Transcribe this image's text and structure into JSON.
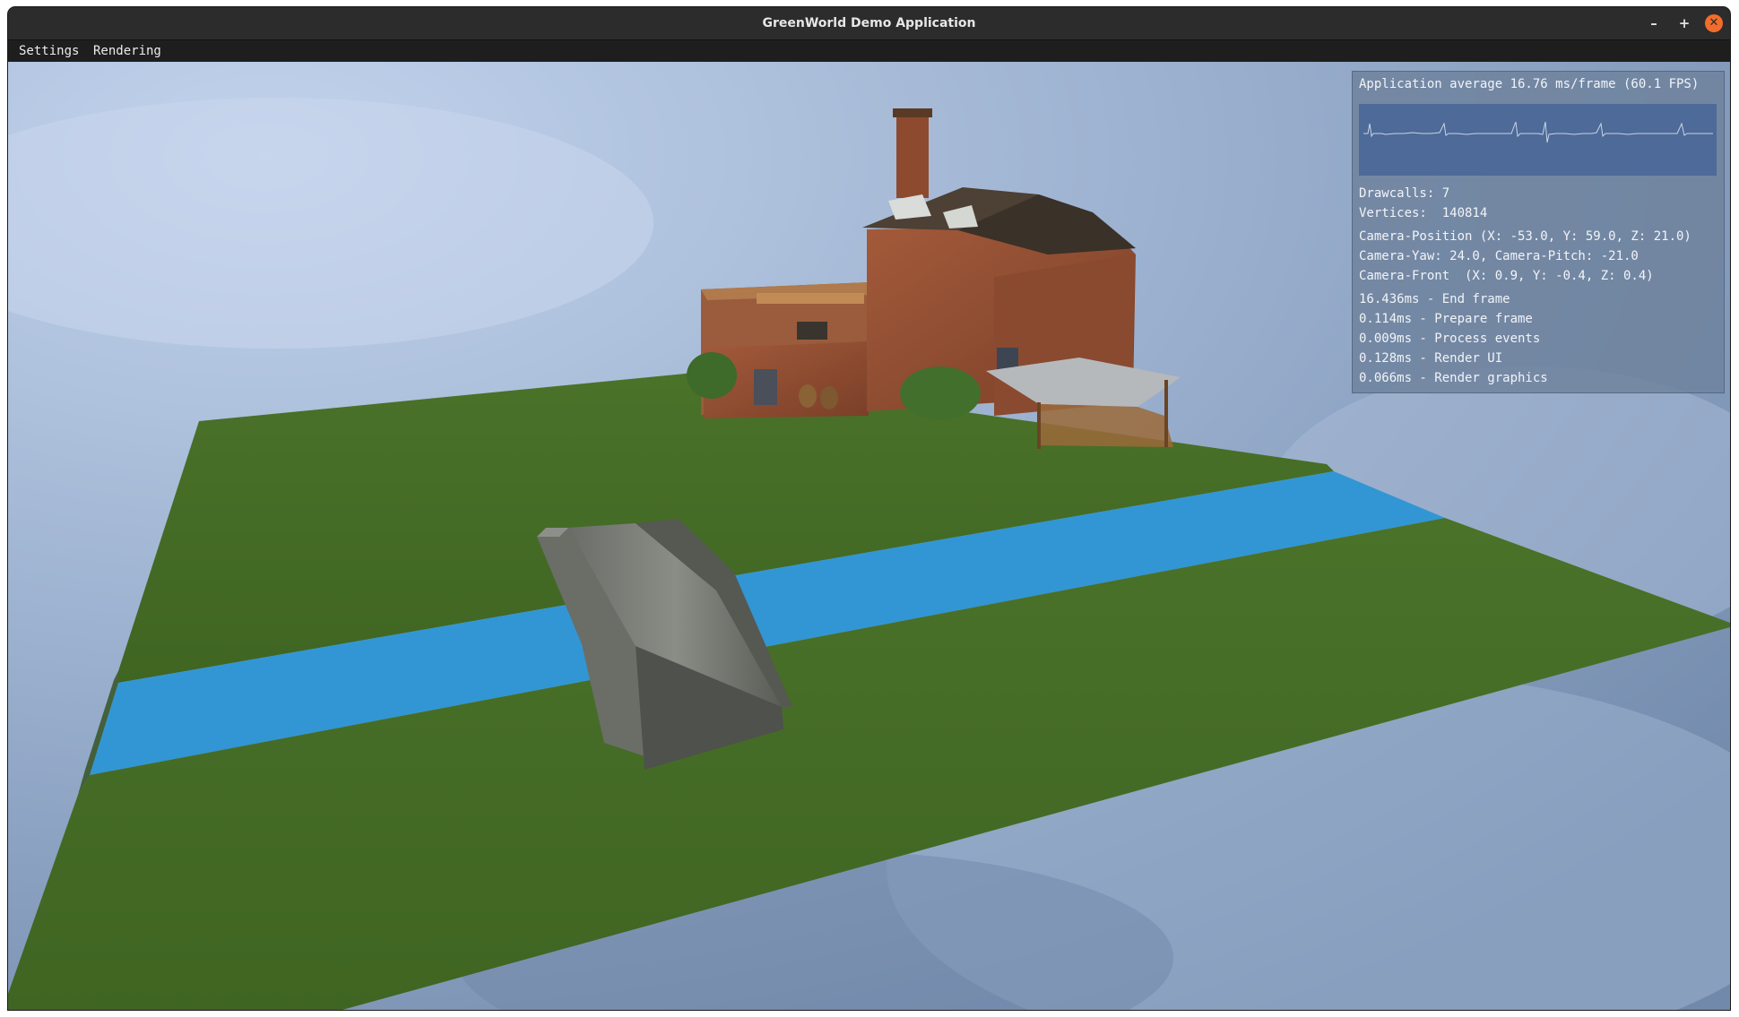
{
  "window": {
    "title": "GreenWorld Demo Application",
    "minimize_glyph": "–",
    "maximize_glyph": "+",
    "close_glyph": "✕"
  },
  "menu": {
    "items": [
      {
        "label": "Settings"
      },
      {
        "label": "Rendering"
      }
    ]
  },
  "stats": {
    "fps_line": "Application average 16.76 ms/frame (60.1 FPS)",
    "drawcalls": "Drawcalls: 7",
    "vertices": "Vertices:  140814",
    "camera_position": "Camera-Position (X: -53.0, Y: 59.0, Z: 21.0)",
    "camera_yaw_pitch": "Camera-Yaw: 24.0, Camera-Pitch: -21.0",
    "camera_front": "Camera-Front  (X: 0.9, Y: -0.4, Z: 0.4)",
    "timings": [
      "16.436ms - End frame",
      "0.114ms - Prepare frame",
      "0.009ms - Process events",
      "0.128ms - Render UI",
      "0.066ms - Render graphics"
    ]
  },
  "colors": {
    "grass": "#456b26",
    "water": "#3296d4",
    "sky": "#8fa6c6",
    "accent_close": "#f26d2b"
  }
}
